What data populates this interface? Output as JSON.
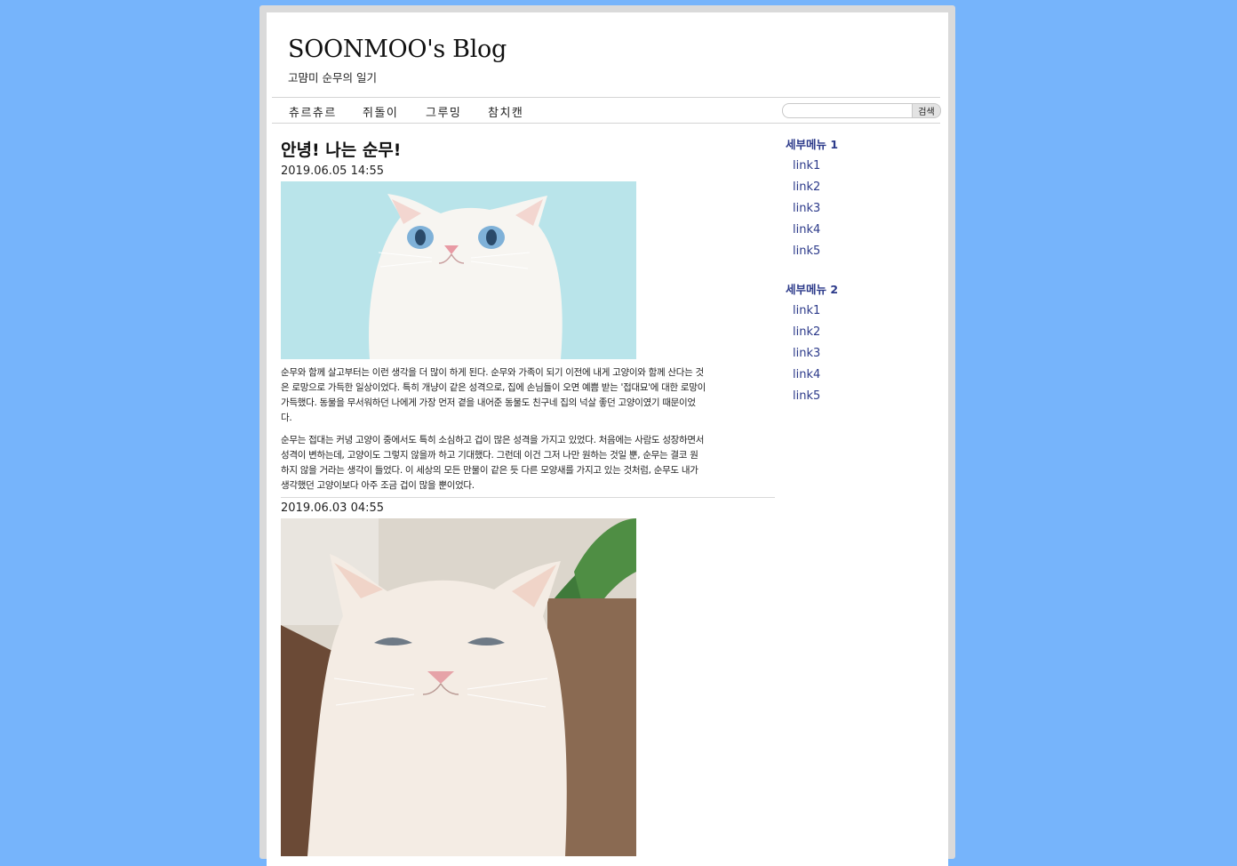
{
  "header": {
    "title": "SOONMOO's Blog",
    "subtitle": "고먐미 순무의 일기"
  },
  "nav": {
    "items": [
      {
        "label": "츄르츄르"
      },
      {
        "label": "쥐돌이"
      },
      {
        "label": "그루밍"
      },
      {
        "label": "참치캔"
      }
    ]
  },
  "search": {
    "placeholder": "",
    "button_label": "검색"
  },
  "posts": [
    {
      "title": "안녕! 나는 순무!",
      "date": "2019.06.05 14:55",
      "image": "white-cat-looking-up-photo",
      "paragraphs": [
        "순무와 함께 살고부터는 이런 생각을 더 많이 하게 된다. 순무와 가족이 되기 이전에 내게 고양이와 함께 산다는 것은 로망으로 가득한 일상이었다. 특히 개냥이 같은 성격으로, 집에 손님들이 오면 예쁨 받는 '접대묘'에 대한 로망이 가득했다. 동물을 무서워하던 나에게 가장 먼저 곁을 내어준 동물도 친구네 집의 넉살 좋던 고양이였기 때문이었다.",
        "순무는 접대는 커녕 고양이 중에서도 특히 소심하고 겁이 많은 성격을 가지고 있었다. 처음에는 사람도 성장하면서 성격이 변하는데, 고양이도 그렇지 않을까 하고 기대했다. 그런데 이건 그저 나만 원하는 것일 뿐, 순무는 결코 원하지 않을 거라는 생각이 들었다. 이 세상의 모든 만물이 같은 듯 다른 모양새를 가지고 있는 것처럼, 순무도 내가 생각했던 고양이보다 아주 조금 겁이 많을 뿐이었다."
      ]
    },
    {
      "date": "2019.06.03 04:55",
      "image": "grumpy-white-cat-photo"
    }
  ],
  "sidebar": {
    "groups": [
      {
        "heading": "세부메뉴 1",
        "links": [
          "link1",
          "link2",
          "link3",
          "link4",
          "link5"
        ]
      },
      {
        "heading": "세부메뉴 2",
        "links": [
          "link1",
          "link2",
          "link3",
          "link4",
          "link5"
        ]
      }
    ]
  },
  "colors": {
    "background": "#76b4fb",
    "frame": "#dadada",
    "sidebar_link": "#2c3a8a",
    "photo1_bg": "#b9e4ea"
  }
}
